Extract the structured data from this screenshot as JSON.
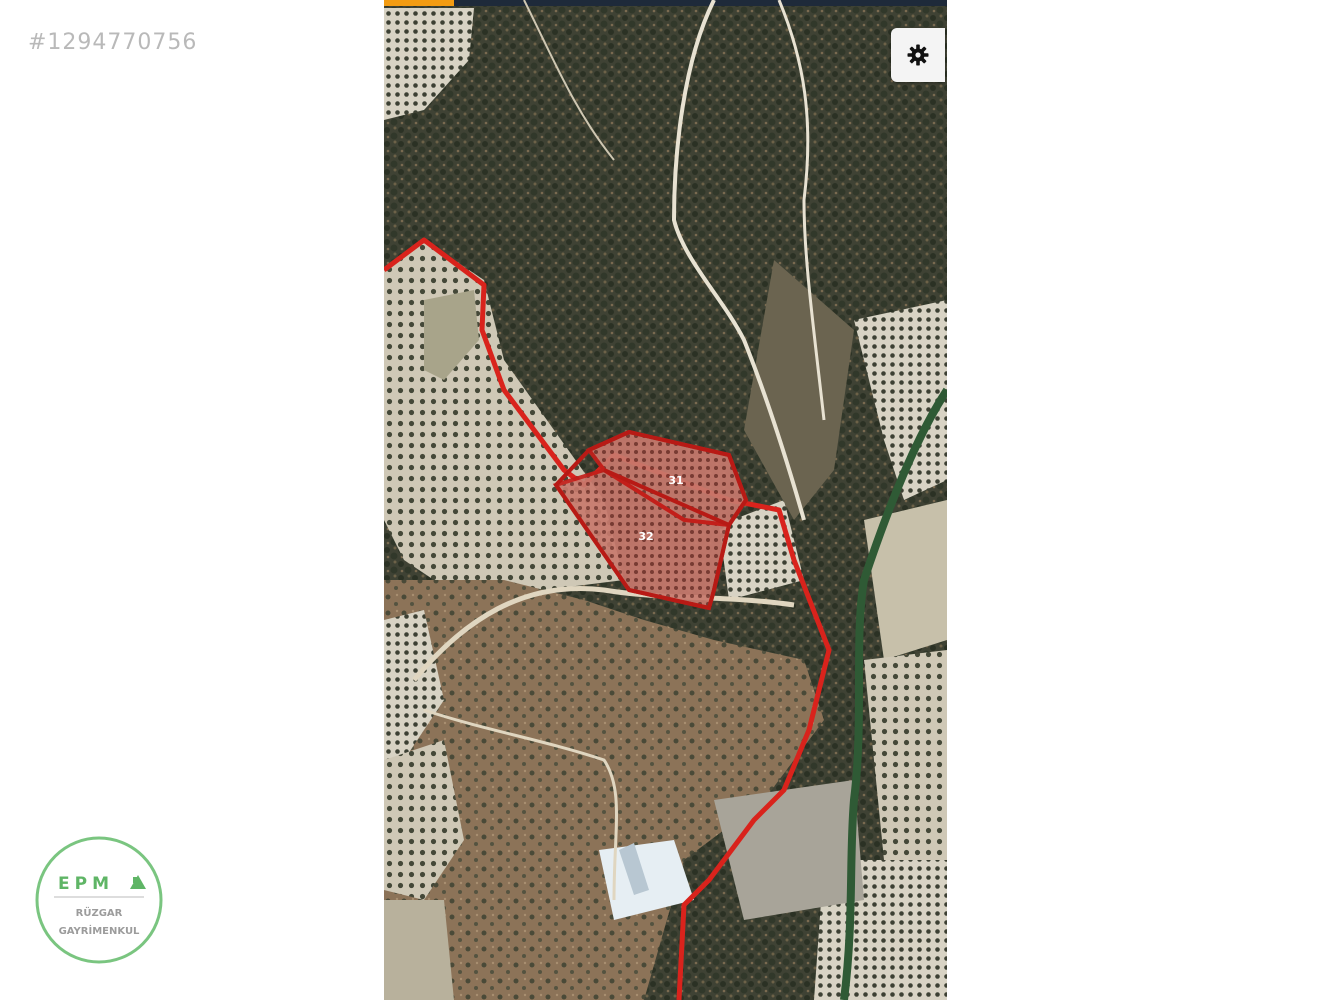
{
  "listing_id": "#1294770756",
  "map": {
    "view": "satellite",
    "parcel_labels": [
      "31",
      "32"
    ],
    "boundary_color": "#d9231c",
    "parcel_fill_color": "#c0392b",
    "settings_icon": "gear-icon"
  },
  "logo": {
    "brand_mark": "EPM",
    "line1": "RÜZGAR",
    "line2": "GAYRİMENKUL",
    "color": "#4caf50"
  }
}
